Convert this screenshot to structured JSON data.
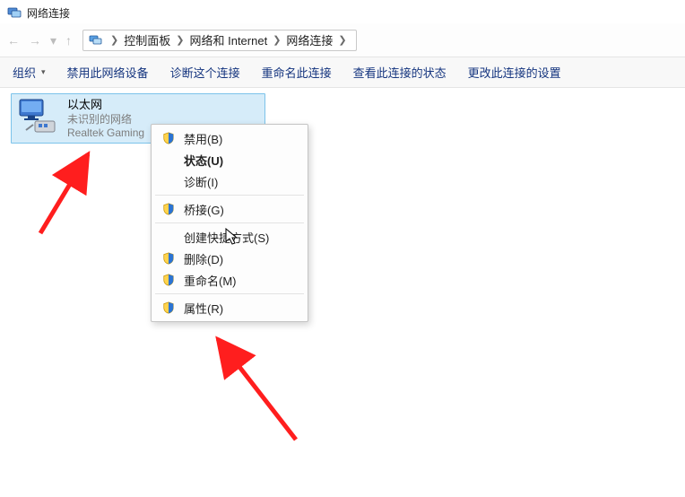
{
  "window": {
    "title": "网络连接"
  },
  "breadcrumbs": {
    "items": [
      "控制面板",
      "网络和 Internet",
      "网络连接"
    ]
  },
  "toolbar": {
    "organize": "组织",
    "disable": "禁用此网络设备",
    "diagnose": "诊断这个连接",
    "rename": "重命名此连接",
    "viewstatus": "查看此连接的状态",
    "changeset": "更改此连接的设置"
  },
  "adapter": {
    "name": "以太网",
    "status": "未识别的网络",
    "device": "Realtek Gaming"
  },
  "contextmenu": {
    "disable": "禁用(B)",
    "status": "状态(U)",
    "diagnose": "诊断(I)",
    "bridge": "桥接(G)",
    "shortcut": "创建快捷方式(S)",
    "delete": "删除(D)",
    "rename": "重命名(M)",
    "properties": "属性(R)"
  }
}
